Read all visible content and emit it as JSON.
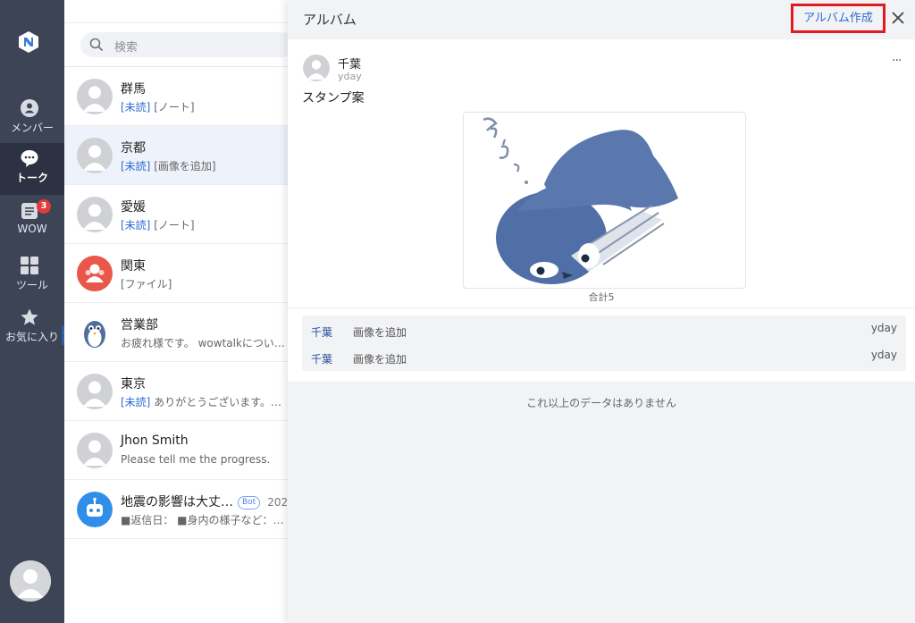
{
  "colors": {
    "nav_bg": "#3d4456",
    "accent": "#2d6bd1",
    "highlight_border": "#e01b22",
    "badge": "#e23c3c"
  },
  "nav": {
    "items": [
      {
        "label": "メンバー",
        "icon": "person-icon"
      },
      {
        "label": "トーク",
        "icon": "chat-bubble-icon",
        "active": true
      },
      {
        "label": "WOW",
        "icon": "note-list-icon",
        "badge": "3"
      },
      {
        "label": "ツール",
        "icon": "grid-icon"
      },
      {
        "label": "お気に入り",
        "icon": "star-icon"
      }
    ]
  },
  "search": {
    "placeholder": "検索"
  },
  "chats": [
    {
      "name": "群馬",
      "unread": "[未読]",
      "preview": " [ノート]"
    },
    {
      "name": "京都",
      "unread": "[未読]",
      "preview": " [画像を追加]"
    },
    {
      "name": "愛媛",
      "unread": "[未読]",
      "preview": " [ノート]"
    },
    {
      "name": "関東",
      "unread": "",
      "preview": "[ファイル]"
    },
    {
      "name": "営業部",
      "unread": "",
      "preview": "お疲れ様です。 wowtalkについ…"
    },
    {
      "name": "東京",
      "unread": "[未読]",
      "preview": " ありがとうございます。…"
    },
    {
      "name": "Jhon Smith",
      "unread": "",
      "preview": "Please tell me the progress."
    },
    {
      "name": "地震の影響は大丈…",
      "badge": "Bot",
      "date": "202",
      "unread": "",
      "preview": "■返信日： ■身内の様子など：…"
    }
  ],
  "album": {
    "title": "アルバム",
    "create_label": "アルバム作成",
    "post": {
      "author": "千葉",
      "time": "yday",
      "more": "···",
      "caption": "スタンプ案",
      "total": "合計5"
    },
    "activity": [
      {
        "name": "千葉",
        "text": "画像を追加",
        "time": "yday"
      },
      {
        "name": "千葉",
        "text": "画像を追加",
        "time": "yday"
      }
    ],
    "no_more": "これ以上のデータはありません"
  }
}
